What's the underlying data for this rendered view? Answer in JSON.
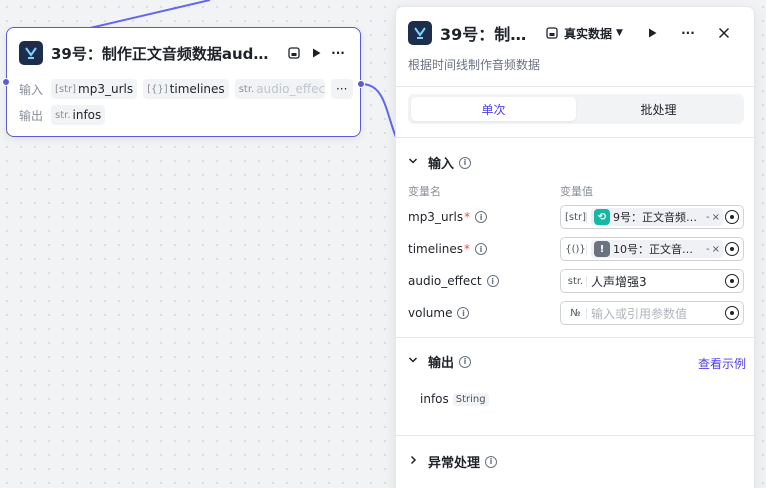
{
  "node": {
    "title": "39号：制作正文音频数据aud…",
    "input_label": "输入",
    "output_label": "输出",
    "inputs": [
      {
        "type": "[str]",
        "name": "mp3_urls"
      },
      {
        "type": "[{}]",
        "name": "timelines"
      },
      {
        "type": "str.",
        "name": "audio_effec"
      }
    ],
    "more": "···",
    "outputs": [
      {
        "type": "str.",
        "name": "infos"
      }
    ]
  },
  "panel": {
    "title": "39号：制…",
    "mode": "真实数据",
    "description": "根据时间线制作音频数据",
    "tabs": [
      {
        "label": "单次",
        "active": true
      },
      {
        "label": "批处理",
        "active": false
      }
    ],
    "input_section": {
      "title": "输入",
      "col_name": "变量名",
      "col_value": "变量值",
      "variables": [
        {
          "name": "mp3_urls",
          "required": true,
          "type": "[str]",
          "ref": "9号：正文音频…",
          "ref_suffix": "-",
          "icon": "loop-icon",
          "icon_color": "#14b8a6"
        },
        {
          "name": "timelines",
          "required": true,
          "type": "{()}",
          "ref": "10号：正文音…",
          "ref_suffix": "-",
          "icon": "exclamation-icon",
          "icon_color": "#6b7280"
        },
        {
          "name": "audio_effect",
          "required": false,
          "type": "str.",
          "value": "人声增强3"
        },
        {
          "name": "volume",
          "required": false,
          "type": "№",
          "placeholder": "输入或引用参数值"
        }
      ]
    },
    "output_section": {
      "title": "输出",
      "example_link": "查看示例",
      "items": [
        {
          "name": "infos",
          "type": "String"
        }
      ]
    },
    "error_section": {
      "title": "异常处理"
    }
  },
  "colors": {
    "accent": "#4e40e5",
    "edge": "#5b5bd6",
    "required": "#f54a45"
  }
}
